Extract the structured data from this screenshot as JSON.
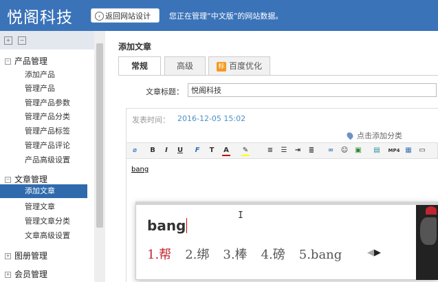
{
  "header": {
    "logo": "悦阁科技",
    "back_label": "返回网站设计",
    "message": "您正在管理“中文版”的网站数据。"
  },
  "sidebar": {
    "groups": [
      {
        "label": "产品管理",
        "toggle": "−",
        "items": [
          "添加产品",
          "管理产品",
          "管理产品参数",
          "管理产品分类",
          "管理产品标签",
          "管理产品评论",
          "产品高级设置"
        ]
      },
      {
        "label": "文章管理",
        "toggle": "−",
        "items": [
          "添加文章",
          "管理文章",
          "管理文章分类",
          "文章高级设置"
        ],
        "active": "添加文章"
      },
      {
        "label": "图册管理",
        "toggle": "+"
      },
      {
        "label": "会员管理",
        "toggle": "+"
      }
    ]
  },
  "main": {
    "title": "添加文章",
    "tabs": [
      {
        "label": "常规",
        "active": true
      },
      {
        "label": "高级",
        "active": false
      },
      {
        "label": "百度优化",
        "icon": "标",
        "active": false
      }
    ],
    "title_field": {
      "label": "文章标题：",
      "value": "悦阁科技"
    },
    "publish": {
      "label": "发表时间：",
      "value": "2016-12-05 15:02"
    },
    "add_category": "点击添加分类",
    "editor_text": "bang"
  },
  "toolbar_icons": [
    "eraser-icon",
    "bold-icon",
    "italic-icon",
    "underline-icon",
    "font-icon",
    "font-size-icon",
    "font-color-icon",
    "highlight-icon",
    "ordered-list-icon",
    "unordered-list-icon",
    "indent-icon",
    "justify-icon",
    "link-icon",
    "emoticon-icon",
    "image-icon",
    "media-icon",
    "flash-icon",
    "table-icon",
    "more-icon"
  ],
  "ime": {
    "input": "bang",
    "candidates": [
      "1.帮",
      "2.绑",
      "3.棒",
      "4.磅",
      "5.bang"
    ]
  },
  "colors": {
    "header": "#3b73b9",
    "active_item": "#2f6aad",
    "ime_first": "#c0262d"
  }
}
